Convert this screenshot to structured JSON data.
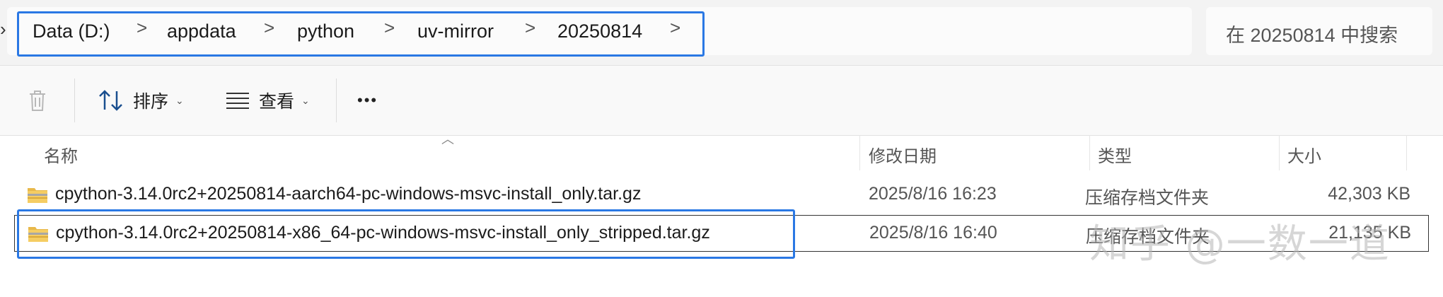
{
  "breadcrumb": {
    "items": [
      "Data (D:)",
      "appdata",
      "python",
      "uv-mirror",
      "20250814"
    ],
    "separator": ">"
  },
  "search": {
    "placeholder": "在 20250814 中搜索"
  },
  "toolbar": {
    "sort_label": "排序",
    "view_label": "查看",
    "more_label": "•••"
  },
  "columns": {
    "name": "名称",
    "modified": "修改日期",
    "type": "类型",
    "size": "大小"
  },
  "files": [
    {
      "name": "cpython-3.14.0rc2+20250814-aarch64-pc-windows-msvc-install_only.tar.gz",
      "modified": "2025/8/16 16:23",
      "type": "压缩存档文件夹",
      "size": "42,303 KB"
    },
    {
      "name": "cpython-3.14.0rc2+20250814-x86_64-pc-windows-msvc-install_only_stripped.tar.gz",
      "modified": "2025/8/16 16:40",
      "type": "压缩存档文件夹",
      "size": "21,135 KB"
    }
  ],
  "watermark": "知乎 @一数一道",
  "colors": {
    "highlight": "#2a78e4",
    "folder_zip": "#e8b84a"
  }
}
